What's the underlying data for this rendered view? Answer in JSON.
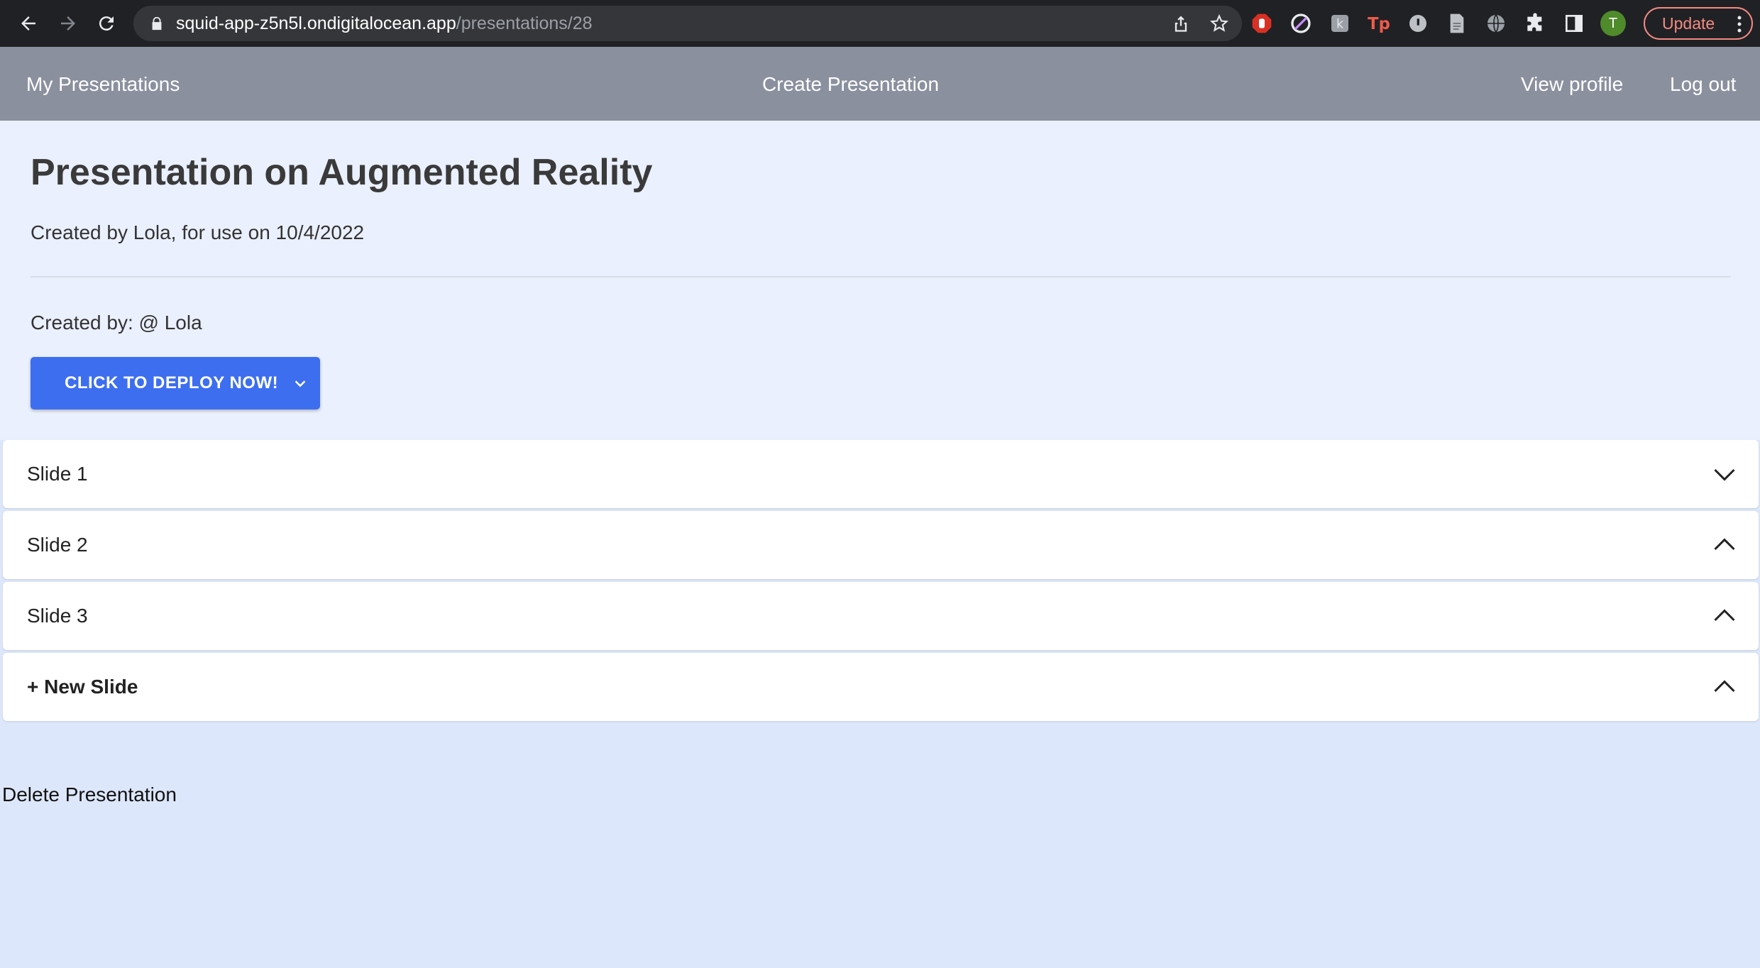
{
  "browser": {
    "url_host": "squid-app-z5n5l.ondigitalocean.app",
    "url_path": "/presentations/28",
    "profile_initial": "T",
    "update_label": "Update",
    "extensions": [
      "stop-icon",
      "no-sign-icon",
      "puzzle-letter-icon",
      "tp-icon",
      "circle-info-icon",
      "document-icon",
      "globe-icon",
      "extensions-puzzle-icon",
      "side-panel-icon"
    ]
  },
  "nav": {
    "my_presentations": "My Presentations",
    "create_presentation": "Create Presentation",
    "view_profile": "View profile",
    "log_out": "Log out"
  },
  "presentation": {
    "title": "Presentation on Augmented Reality",
    "subtitle": "Created by Lola, for use on 10/4/2022",
    "created_by": "Created by: @ Lola",
    "deploy_label": "CLICK TO DEPLOY NOW!"
  },
  "slides": [
    {
      "label": "Slide 1",
      "chevron": "down"
    },
    {
      "label": "Slide 2",
      "chevron": "up"
    },
    {
      "label": "Slide 3",
      "chevron": "up"
    },
    {
      "label": "+ New Slide",
      "chevron": "up"
    }
  ],
  "delete_label": "Delete Presentation",
  "colors": {
    "navbar": "#8a909e",
    "header_bg": "#eaf0fd",
    "page_bg": "#dde7fb",
    "primary_button": "#3d6ef0"
  }
}
